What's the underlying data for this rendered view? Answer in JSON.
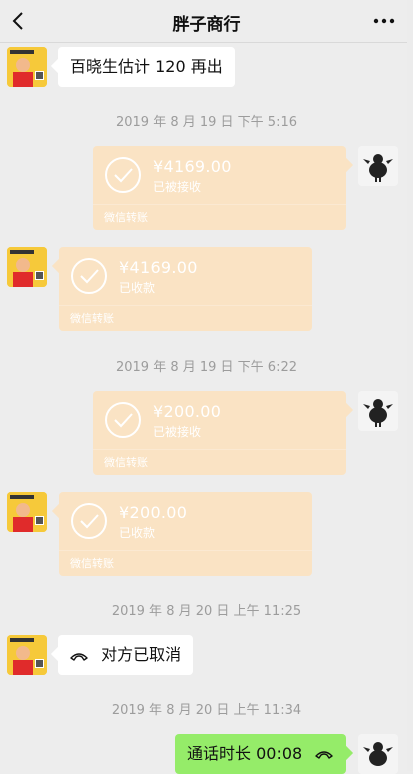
{
  "header": {
    "title": "胖子商行"
  },
  "messages": {
    "m1": {
      "text": "百晓生估计 120 再出"
    },
    "t1": {
      "time": "2019 年 8 月 19 日 下午 5:16"
    },
    "tr1": {
      "amount": "¥4169.00",
      "status": "已被接收",
      "footer": "微信转账"
    },
    "tr2": {
      "amount": "¥4169.00",
      "status": "已收款",
      "footer": "微信转账"
    },
    "t2": {
      "time": "2019 年 8 月 19 日 下午 6:22"
    },
    "tr3": {
      "amount": "¥200.00",
      "status": "已被接收",
      "footer": "微信转账"
    },
    "tr4": {
      "amount": "¥200.00",
      "status": "已收款",
      "footer": "微信转账"
    },
    "t3": {
      "time": "2019 年 8 月 20 日 上午 11:25"
    },
    "call1": {
      "text": "对方已取消"
    },
    "t4": {
      "time": "2019 年 8 月 20 日 上午 11:34"
    },
    "call2": {
      "text": "通话时长 00:08"
    }
  },
  "colors": {
    "background": "#ededed",
    "bubble_white": "#ffffff",
    "bubble_green": "#95ec69",
    "transfer": "#fae3c4",
    "timestamp": "#9c9c9c"
  },
  "icons": {
    "back": "chevron-left-icon",
    "more": "more-icon",
    "transfer": "check-circle-icon",
    "call": "phone-hangup-icon"
  }
}
